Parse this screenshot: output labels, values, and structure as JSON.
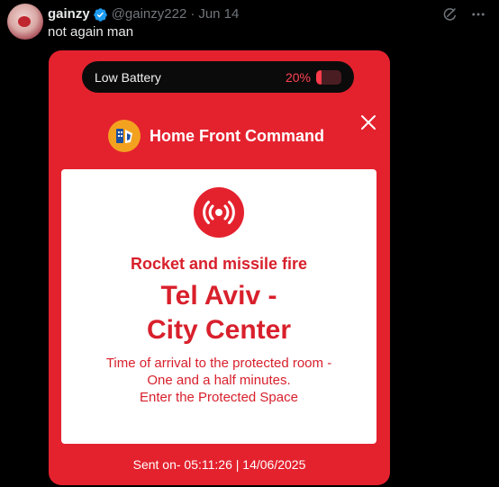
{
  "tweet": {
    "display_name": "gainzy",
    "handle": "@gainzy222",
    "separator": "·",
    "date": "Jun 14",
    "text": "not again man",
    "icons": [
      "grok-icon",
      "more-icon"
    ]
  },
  "media": {
    "battery": {
      "label": "Low Battery",
      "percent_text": "20%",
      "level": 0.2
    },
    "app_name": "Home Front Command",
    "alert": {
      "type": "Rocket and missile fire",
      "location_lines": [
        "Tel Aviv -",
        "City Center"
      ],
      "instruction_lines": [
        "Time of arrival to the protected room -",
        "One and a half minutes.",
        "Enter the Protected Space"
      ]
    },
    "sent_on": "Sent on- 05:11:26 | 14/06/2025"
  },
  "colors": {
    "background": "#000000",
    "alert_red": "#e4222e",
    "verified_blue": "#1d9bf0",
    "muted_text": "#71767b"
  }
}
